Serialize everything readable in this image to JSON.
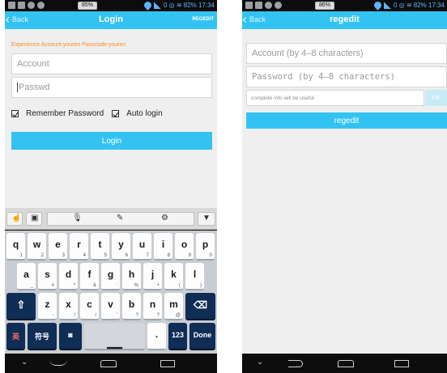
{
  "login": {
    "status_battery": "85%",
    "status_right": "0 ◎ ≋ 82% 17:34",
    "back_label": "Back",
    "title": "Login",
    "regedit_label": "REGEDIT",
    "hint": "Experience Account:youren Passcode:youren",
    "account_placeholder": "Account",
    "password_placeholder": "Passwd",
    "remember_label": "Remember Password",
    "auto_label": "Auto login",
    "login_button": "Login"
  },
  "keyboard": {
    "row1": [
      [
        "q",
        "1"
      ],
      [
        "w",
        "2"
      ],
      [
        "e",
        "3"
      ],
      [
        "r",
        "4"
      ],
      [
        "t",
        "5"
      ],
      [
        "y",
        "6"
      ],
      [
        "u",
        "7"
      ],
      [
        "i",
        "8"
      ],
      [
        "o",
        "9"
      ],
      [
        "p",
        "0"
      ]
    ],
    "row2": [
      [
        "a",
        "_"
      ],
      [
        "s",
        "#"
      ],
      [
        "d",
        "*"
      ],
      [
        "f",
        "&"
      ],
      [
        "g",
        ":"
      ],
      [
        "h",
        "%"
      ],
      [
        "j",
        "+"
      ],
      [
        "k",
        "("
      ],
      [
        "l",
        ")"
      ]
    ],
    "row3": [
      [
        "z",
        "-"
      ],
      [
        "x",
        "!"
      ],
      [
        "c",
        "/"
      ],
      [
        "v",
        "'"
      ],
      [
        "b",
        "?"
      ],
      [
        "n",
        "?"
      ],
      [
        "m",
        "@"
      ]
    ],
    "symbols_label": "符号",
    "lang_label": "英",
    "num_label": "123",
    "done_label": "Done",
    "period_label": "."
  },
  "regedit": {
    "status_battery": "86%",
    "status_right": "0 ◎ ≋ 82% 17:34",
    "back_label": "Back",
    "title": "regedit",
    "account_placeholder": "Account (by 4–8 characters)",
    "password_placeholder": "Password (by 4–8 characters)",
    "info_placeholder": "complete info will be useful",
    "ok_label": "OK",
    "regedit_button": "regedit"
  },
  "colors": {
    "accent": "#33c3f2",
    "hint_orange": "#ff8c1a",
    "keyboard_dark": "#0f2d55"
  },
  "icons": [
    "back-chevron-icon",
    "checkbox-checked-icon",
    "shift-icon",
    "backspace-icon",
    "mic-icon",
    "handwriting-icon",
    "settings-icon",
    "keyboard-hide-icon",
    "nav-back-icon",
    "nav-home-icon",
    "nav-recents-icon",
    "nav-down-icon"
  ]
}
